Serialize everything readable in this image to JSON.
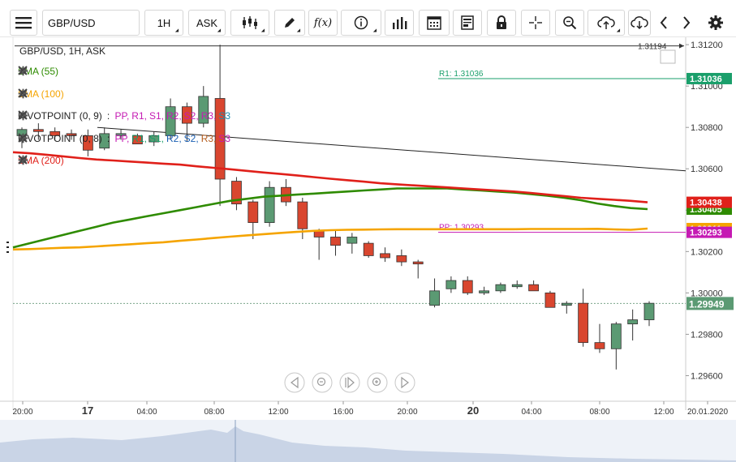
{
  "toolbar": {
    "symbol": "GBP/USD",
    "interval": "1H",
    "price_type": "ASK"
  },
  "header": {
    "title": "GBP/USD, 1H, ASK"
  },
  "indicators": [
    {
      "label": "SMA (55)",
      "color": "#2e8b00"
    },
    {
      "label": "SMA (100)",
      "color": "#f5a400"
    },
    {
      "label": "PIVOTPOINT (0, 9)",
      "color": "#222222",
      "levels_prefix": ": ",
      "levels": [
        {
          "t": "PP,",
          "c": "#c51ab3"
        },
        {
          "t": "R1,",
          "c": "#c51ab3"
        },
        {
          "t": "S1,",
          "c": "#c51ab3"
        },
        {
          "t": "R2,",
          "c": "#c51ab3"
        },
        {
          "t": "S2,",
          "c": "#c51ab3"
        },
        {
          "t": "R3,",
          "c": "#c51ab3"
        },
        {
          "t": "S3",
          "c": "#1a8fb3"
        }
      ]
    },
    {
      "label": "PIVOTPOINT (0, 8)",
      "color": "#222222",
      "levels_prefix": ": ",
      "levels": [
        {
          "t": "PP,",
          "c": "#c51ab3"
        },
        {
          "t": "R1,",
          "c": "#1a9f6b"
        },
        {
          "t": "S1,",
          "c": "#1a9f6b"
        },
        {
          "t": "R2,",
          "c": "#1a5fb3"
        },
        {
          "t": "S2,",
          "c": "#1a5fb3"
        },
        {
          "t": "R3,",
          "c": "#b35a1a"
        },
        {
          "t": "S3",
          "c": "#c51ab3"
        }
      ]
    },
    {
      "label": "SMA (200)",
      "color": "#e0201a"
    }
  ],
  "chart_labels": {
    "r1": "R1: 1.31036",
    "pp": "PP: 1.30293"
  },
  "price_axis": {
    "ticks": [
      "1.31200",
      "1.31000",
      "1.30800",
      "1.30600",
      "1.30400",
      "1.30200",
      "1.30000",
      "1.29800",
      "1.29600"
    ],
    "marker_top": "1.31194",
    "badge_r1": "1.31036",
    "badge_sma200": "1.30438",
    "badge_sma55": "1.30405",
    "badge_sma100": "1.30311",
    "badge_pp": "1.30293",
    "badge_last": "1.29949"
  },
  "time_axis": {
    "labels": [
      "20:00",
      "17",
      "04:00",
      "08:00",
      "12:00",
      "16:00",
      "20:00",
      "20",
      "04:00",
      "08:00",
      "12:00",
      "20.01.2020"
    ]
  },
  "colors": {
    "bull": "#5b9a73",
    "bear": "#d9462f",
    "sma55": "#2e8b00",
    "sma100": "#f5a400",
    "sma200": "#e0201a",
    "r1": "#1a9f6b",
    "pp": "#c51ab3",
    "last": "#5b9a73"
  },
  "chart_data": {
    "type": "candlestick",
    "symbol": "GBP/USD",
    "interval": "1H",
    "ylim": [
      1.295,
      1.3122
    ],
    "candles": [
      {
        "o": 1.3076,
        "h": 1.308,
        "l": 1.307,
        "c": 1.3079
      },
      {
        "o": 1.3079,
        "h": 1.3082,
        "l": 1.3074,
        "c": 1.3078
      },
      {
        "o": 1.3078,
        "h": 1.308,
        "l": 1.3074,
        "c": 1.3076
      },
      {
        "o": 1.3077,
        "h": 1.3079,
        "l": 1.3074,
        "c": 1.3076
      },
      {
        "o": 1.3076,
        "h": 1.3079,
        "l": 1.3066,
        "c": 1.3069
      },
      {
        "o": 1.307,
        "h": 1.308,
        "l": 1.3069,
        "c": 1.3077
      },
      {
        "o": 1.3076,
        "h": 1.3079,
        "l": 1.3074,
        "c": 1.3077
      },
      {
        "o": 1.3076,
        "h": 1.3077,
        "l": 1.3072,
        "c": 1.3072
      },
      {
        "o": 1.3073,
        "h": 1.3078,
        "l": 1.3071,
        "c": 1.3076
      },
      {
        "o": 1.3076,
        "h": 1.3094,
        "l": 1.3074,
        "c": 1.309
      },
      {
        "o": 1.309,
        "h": 1.3092,
        "l": 1.3073,
        "c": 1.3082
      },
      {
        "o": 1.3082,
        "h": 1.31,
        "l": 1.308,
        "c": 1.3095
      },
      {
        "o": 1.3094,
        "h": 1.312,
        "l": 1.3042,
        "c": 1.3055
      },
      {
        "o": 1.3054,
        "h": 1.3056,
        "l": 1.304,
        "c": 1.3043
      },
      {
        "o": 1.3044,
        "h": 1.3045,
        "l": 1.3026,
        "c": 1.3034
      },
      {
        "o": 1.3034,
        "h": 1.3054,
        "l": 1.3032,
        "c": 1.3051
      },
      {
        "o": 1.3051,
        "h": 1.3055,
        "l": 1.3042,
        "c": 1.3044
      },
      {
        "o": 1.3044,
        "h": 1.3046,
        "l": 1.3026,
        "c": 1.3031
      },
      {
        "o": 1.303,
        "h": 1.3031,
        "l": 1.3016,
        "c": 1.3027
      },
      {
        "o": 1.3027,
        "h": 1.303,
        "l": 1.3018,
        "c": 1.3023
      },
      {
        "o": 1.3024,
        "h": 1.3029,
        "l": 1.3019,
        "c": 1.3027
      },
      {
        "o": 1.3024,
        "h": 1.3025,
        "l": 1.3017,
        "c": 1.3018
      },
      {
        "o": 1.3019,
        "h": 1.3022,
        "l": 1.3015,
        "c": 1.3017
      },
      {
        "o": 1.3018,
        "h": 1.3021,
        "l": 1.3013,
        "c": 1.3015
      },
      {
        "o": 1.3015,
        "h": 1.3016,
        "l": 1.3007,
        "c": 1.3014
      },
      {
        "o": 1.2994,
        "h": 1.3007,
        "l": 1.2993,
        "c": 1.3001
      },
      {
        "o": 1.3002,
        "h": 1.3008,
        "l": 1.3,
        "c": 1.3006
      },
      {
        "o": 1.3006,
        "h": 1.3008,
        "l": 1.2999,
        "c": 1.3
      },
      {
        "o": 1.3,
        "h": 1.3003,
        "l": 1.2999,
        "c": 1.3001
      },
      {
        "o": 1.3001,
        "h": 1.3005,
        "l": 1.3,
        "c": 1.3004
      },
      {
        "o": 1.3003,
        "h": 1.3006,
        "l": 1.3002,
        "c": 1.3004
      },
      {
        "o": 1.3004,
        "h": 1.3006,
        "l": 1.3001,
        "c": 1.3001
      },
      {
        "o": 1.3,
        "h": 1.3001,
        "l": 1.2993,
        "c": 1.2993
      },
      {
        "o": 1.2994,
        "h": 1.2996,
        "l": 1.299,
        "c": 1.2995
      },
      {
        "o": 1.2995,
        "h": 1.3002,
        "l": 1.2974,
        "c": 1.2976
      },
      {
        "o": 1.2976,
        "h": 1.2985,
        "l": 1.2971,
        "c": 1.2973
      },
      {
        "o": 1.2973,
        "h": 1.2986,
        "l": 1.2963,
        "c": 1.2985
      },
      {
        "o": 1.2985,
        "h": 1.2992,
        "l": 1.2977,
        "c": 1.2987
      },
      {
        "o": 1.2987,
        "h": 1.2996,
        "l": 1.2984,
        "c": 1.2995
      }
    ],
    "sma55": [
      1.3022,
      1.3024,
      1.3026,
      1.3028,
      1.303,
      1.3032,
      1.3034,
      1.30355,
      1.3037,
      1.30385,
      1.304,
      1.30415,
      1.3043,
      1.30445,
      1.30455,
      1.30465,
      1.3047,
      1.30475,
      1.3048,
      1.30485,
      1.3049,
      1.30495,
      1.305,
      1.30505,
      1.30505,
      1.30505,
      1.30505,
      1.305,
      1.30495,
      1.3049,
      1.30485,
      1.30478,
      1.3047,
      1.3046,
      1.30448,
      1.30432,
      1.3042,
      1.3041,
      1.30405
    ],
    "sma100": [
      1.3021,
      1.30212,
      1.30215,
      1.30218,
      1.3022,
      1.30225,
      1.3023,
      1.30235,
      1.3024,
      1.30245,
      1.30252,
      1.30258,
      1.30265,
      1.30272,
      1.30278,
      1.30284,
      1.3029,
      1.30295,
      1.303,
      1.30303,
      1.30305,
      1.30306,
      1.30307,
      1.30308,
      1.30308,
      1.30308,
      1.30308,
      1.30308,
      1.30308,
      1.30308,
      1.30308,
      1.30309,
      1.30309,
      1.30309,
      1.30309,
      1.3031,
      1.30307,
      1.30305,
      1.30311
    ],
    "sma200": [
      1.3068,
      1.30675,
      1.30668,
      1.3066,
      1.30652,
      1.30645,
      1.3064,
      1.30635,
      1.3063,
      1.30625,
      1.3062,
      1.30612,
      1.30605,
      1.30598,
      1.3059,
      1.30582,
      1.30575,
      1.30568,
      1.3056,
      1.30552,
      1.30545,
      1.30538,
      1.3053,
      1.30525,
      1.3052,
      1.30515,
      1.3051,
      1.30505,
      1.305,
      1.30495,
      1.3049,
      1.30483,
      1.30475,
      1.30468,
      1.3046,
      1.30455,
      1.3045,
      1.30445,
      1.30438
    ],
    "trendline": {
      "from": 1.308,
      "to": 1.3059
    },
    "levels": {
      "r1": 1.31036,
      "pp": 1.30293,
      "top_marker": 1.31194,
      "last": 1.29949
    }
  }
}
